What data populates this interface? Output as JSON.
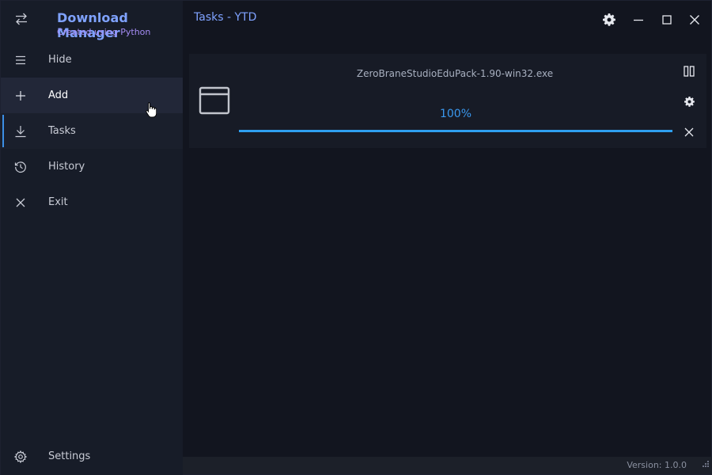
{
  "app": {
    "title": "Download Manager",
    "subtitle": "Created using Python",
    "page_title": "Tasks - YTD"
  },
  "sidebar": {
    "items": [
      {
        "label": "Hide",
        "icon": "menu-icon"
      },
      {
        "label": "Add",
        "icon": "plus-icon"
      },
      {
        "label": "Tasks",
        "icon": "download-icon"
      },
      {
        "label": "History",
        "icon": "history-icon"
      },
      {
        "label": "Exit",
        "icon": "close-icon"
      }
    ],
    "settings_label": "Settings"
  },
  "task": {
    "file_name": "ZeroBraneStudioEduPack-1.90-win32.exe",
    "progress_text": "100%",
    "progress": 1.0
  },
  "status_bar": {
    "version": "Version: 1.0.0"
  },
  "colors": {
    "accent": "#7fa2ff",
    "subtitle": "#a58cf5",
    "progress": "#2e9ff0",
    "sidebar_bg": "#171c28",
    "main_bg": "#12151f"
  }
}
